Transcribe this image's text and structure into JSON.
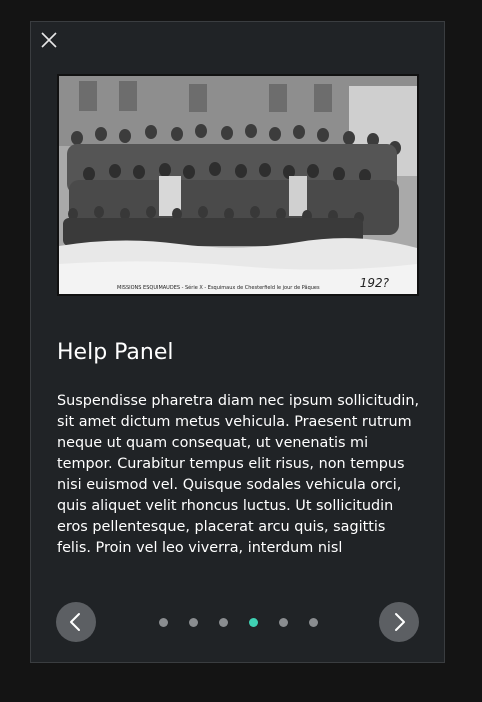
{
  "panel": {
    "title": "Help Panel",
    "body": "Suspendisse pharetra diam nec ipsum sollicitudin, sit amet dictum metus vehicula. Praesent rutrum neque ut quam consequat, ut venenatis mi tempor. Curabitur tempus elit risus, non tempus nisi euismod vel. Quisque sodales vehicula orci, quis aliquet velit rhoncus luctus. Ut sollicitudin eros pellentesque, placerat arcu quis, sagittis felis. Proin vel leo viverra, interdum nisl"
  },
  "photo": {
    "caption": "MISSIONS ESQUIMAUDES - Série X - Esquimaux de Chesterfield le jour de Pâques",
    "number": "192?"
  },
  "pagination": {
    "total": 6,
    "active_index": 3
  },
  "icons": {
    "close": "close-icon",
    "prev": "chevron-left-icon",
    "next": "chevron-right-icon"
  },
  "colors": {
    "panel_bg": "#202326",
    "page_bg": "#141414",
    "active_dot": "#3fd1b3",
    "inactive_dot": "#8a8d90",
    "nav_button": "#5c5f63"
  }
}
